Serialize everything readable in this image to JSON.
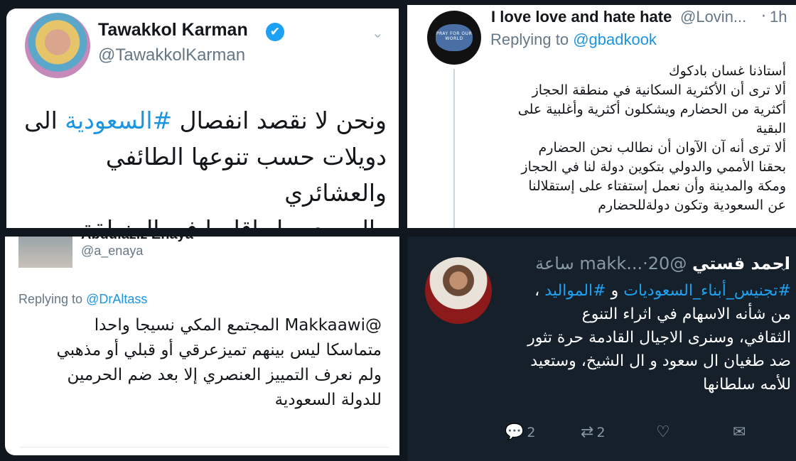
{
  "panel1": {
    "name": "Tawakkol Karman",
    "handle": "@TawakkolKarman",
    "verified_icon": "✔",
    "chevron_icon": "⌄",
    "body_lines": [
      [
        "ونحن لا نقصد انفصال ",
        "#السعودية",
        " الى"
      ],
      [
        "دويلات حسب تنوعها الطائفي والعشائري",
        "",
        ""
      ],
      [
        "والجهوي، بل اقليما في المنطقة الشرقية",
        "",
        ""
      ]
    ]
  },
  "panel2": {
    "avatar_text": "PRAY FOR OUR WORLD",
    "name": "I love love and hate hate",
    "handle": "@Lovin...",
    "dot": "·",
    "time": "1h",
    "reply_prefix": "Replying to ",
    "reply_handle": "@gbadkook",
    "body_lines": [
      "أستاذنا غسان بادكوك",
      "ألا ترى أن الأكثرية السكانية في منطقة الحجاز",
      "أكثرية من الحضارم ويشكلون أكثرية وأغلبية على",
      "البقية",
      "ألا ترى أنه آن الآوان أن نطالب نحن الحضارم",
      "بحقنا الأممي والدولي بتكوين دولة لنا في الحجاز",
      "ومكة والمدينة وأن نعمل إستفتاء على إستقلالنا",
      "عن السعودية وتكون دولةللحضارم"
    ]
  },
  "panel3": {
    "name": "Abdulaziz Enaya",
    "handle": "@a_enaya",
    "reply_prefix": "Replying to ",
    "reply_handle": "@DrAltass",
    "body_lines": [
      "@Makkaawi المجتمع المكي نسيجا واحدا",
      "متماسكا ليس بينهم تميزعرقي أو قبلي أو مذهبي",
      "ولم نعرف التمييز العنصري إلا بعد ضم الحرمين",
      "للدولة السعودية"
    ]
  },
  "panel4": {
    "name": "احمد قستي",
    "handle": "@makk...",
    "time": "20 ساعة",
    "dot": "·",
    "chevron_icon": "⌄",
    "hashtag1": "#تجنيس_أبناء_السعوديات",
    "conj": " و ",
    "hashtag2": "#المواليد",
    "comma": " ،",
    "body_lines": [
      "من شأنه الاسهام في اثراء التنوع",
      "الثقافي، وسنرى الاجيال القادمة حرة تثور",
      "ضد طغيان ال سعود و ال الشيخ، وستعيد",
      "للأمه سلطانها"
    ],
    "actions": {
      "reply_icon": "💬",
      "reply_count": "2",
      "retweet_icon": "⇄",
      "retweet_count": "2",
      "like_icon": "♡",
      "message_icon": "✉"
    }
  }
}
